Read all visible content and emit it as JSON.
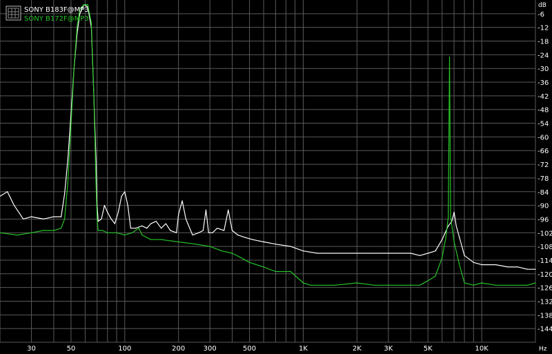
{
  "chart_data": {
    "type": "line",
    "title": "",
    "xlabel": "Hz",
    "ylabel": "dB",
    "x_scale": "log",
    "xlim": [
      20,
      20000
    ],
    "ylim": [
      -150,
      0
    ],
    "grid": true,
    "legend_position": "top-left",
    "y_ticks": [
      -6,
      -12,
      -18,
      -24,
      -30,
      -36,
      -42,
      -48,
      -54,
      -60,
      -66,
      -72,
      -78,
      -84,
      -90,
      -96,
      -102,
      -108,
      -114,
      -120,
      -126,
      -132,
      -138,
      -144
    ],
    "x_ticks": [
      {
        "value": 30,
        "label": "30"
      },
      {
        "value": 50,
        "label": "50"
      },
      {
        "value": 100,
        "label": "100"
      },
      {
        "value": 200,
        "label": "200"
      },
      {
        "value": 300,
        "label": "300"
      },
      {
        "value": 500,
        "label": "500"
      },
      {
        "value": 1000,
        "label": "1K"
      },
      {
        "value": 2000,
        "label": "2K"
      },
      {
        "value": 3000,
        "label": "3K"
      },
      {
        "value": 5000,
        "label": "5K"
      },
      {
        "value": 10000,
        "label": "10K"
      }
    ],
    "series": [
      {
        "name": "SONY B183F@MP3",
        "color": "#ffffff",
        "points": [
          [
            20,
            -86
          ],
          [
            22,
            -84
          ],
          [
            24,
            -90
          ],
          [
            27,
            -96
          ],
          [
            30,
            -95
          ],
          [
            35,
            -96
          ],
          [
            40,
            -95
          ],
          [
            44,
            -95
          ],
          [
            46,
            -85
          ],
          [
            48,
            -70
          ],
          [
            50,
            -50
          ],
          [
            52,
            -30
          ],
          [
            54,
            -15
          ],
          [
            56,
            -6
          ],
          [
            59,
            -2
          ],
          [
            62,
            -3
          ],
          [
            65,
            -12
          ],
          [
            67,
            -40
          ],
          [
            69,
            -70
          ],
          [
            70,
            -90
          ],
          [
            71,
            -97
          ],
          [
            74,
            -96
          ],
          [
            77,
            -90
          ],
          [
            80,
            -93
          ],
          [
            84,
            -96
          ],
          [
            88,
            -98
          ],
          [
            92,
            -93
          ],
          [
            96,
            -86
          ],
          [
            100,
            -84
          ],
          [
            104,
            -90
          ],
          [
            108,
            -100
          ],
          [
            115,
            -100
          ],
          [
            125,
            -99
          ],
          [
            133,
            -100
          ],
          [
            140,
            -98
          ],
          [
            150,
            -97
          ],
          [
            160,
            -100
          ],
          [
            170,
            -98
          ],
          [
            180,
            -101
          ],
          [
            195,
            -102
          ],
          [
            200,
            -94
          ],
          [
            210,
            -88
          ],
          [
            220,
            -96
          ],
          [
            240,
            -103
          ],
          [
            260,
            -102
          ],
          [
            275,
            -101
          ],
          [
            285,
            -92
          ],
          [
            295,
            -102
          ],
          [
            310,
            -102
          ],
          [
            330,
            -100
          ],
          [
            360,
            -101
          ],
          [
            380,
            -92
          ],
          [
            400,
            -101
          ],
          [
            430,
            -103
          ],
          [
            470,
            -104
          ],
          [
            520,
            -105
          ],
          [
            600,
            -106
          ],
          [
            700,
            -107
          ],
          [
            850,
            -108
          ],
          [
            1000,
            -110
          ],
          [
            1200,
            -111
          ],
          [
            1500,
            -111
          ],
          [
            2000,
            -111
          ],
          [
            2500,
            -111
          ],
          [
            3000,
            -111
          ],
          [
            3500,
            -111
          ],
          [
            4000,
            -111
          ],
          [
            4500,
            -112
          ],
          [
            5000,
            -111
          ],
          [
            5500,
            -110
          ],
          [
            6000,
            -105
          ],
          [
            6500,
            -99
          ],
          [
            6800,
            -97
          ],
          [
            7000,
            -93
          ],
          [
            7200,
            -99
          ],
          [
            7500,
            -104
          ],
          [
            8000,
            -112
          ],
          [
            9000,
            -115
          ],
          [
            10000,
            -116
          ],
          [
            12000,
            -116
          ],
          [
            14000,
            -117
          ],
          [
            16000,
            -117
          ],
          [
            18000,
            -118
          ],
          [
            20000,
            -118
          ]
        ]
      },
      {
        "name": "SONY B172F@MP3",
        "color": "#27c427",
        "points": [
          [
            20,
            -102
          ],
          [
            25,
            -103
          ],
          [
            30,
            -102
          ],
          [
            35,
            -101
          ],
          [
            40,
            -101
          ],
          [
            44,
            -100
          ],
          [
            46,
            -96
          ],
          [
            48,
            -80
          ],
          [
            50,
            -55
          ],
          [
            52,
            -30
          ],
          [
            54,
            -12
          ],
          [
            56,
            -4
          ],
          [
            59,
            -2
          ],
          [
            62,
            -2
          ],
          [
            65,
            -10
          ],
          [
            67,
            -40
          ],
          [
            69,
            -80
          ],
          [
            70,
            -96
          ],
          [
            71,
            -101
          ],
          [
            75,
            -101
          ],
          [
            80,
            -102
          ],
          [
            90,
            -102
          ],
          [
            100,
            -103
          ],
          [
            110,
            -102
          ],
          [
            120,
            -100
          ],
          [
            125,
            -103
          ],
          [
            140,
            -105
          ],
          [
            160,
            -105
          ],
          [
            200,
            -106
          ],
          [
            250,
            -107
          ],
          [
            300,
            -108
          ],
          [
            350,
            -110
          ],
          [
            400,
            -111
          ],
          [
            450,
            -113
          ],
          [
            500,
            -115
          ],
          [
            600,
            -117
          ],
          [
            700,
            -119
          ],
          [
            850,
            -119
          ],
          [
            1000,
            -124
          ],
          [
            1100,
            -125
          ],
          [
            1300,
            -125
          ],
          [
            1500,
            -125
          ],
          [
            2000,
            -124
          ],
          [
            2500,
            -125
          ],
          [
            3000,
            -125
          ],
          [
            3500,
            -125
          ],
          [
            4000,
            -125
          ],
          [
            4500,
            -125
          ],
          [
            5000,
            -123
          ],
          [
            5500,
            -121
          ],
          [
            6000,
            -113
          ],
          [
            6300,
            -104
          ],
          [
            6500,
            -95
          ],
          [
            6600,
            -25
          ],
          [
            6700,
            -95
          ],
          [
            7000,
            -106
          ],
          [
            7500,
            -116
          ],
          [
            8000,
            -124
          ],
          [
            9000,
            -125
          ],
          [
            10000,
            -124
          ],
          [
            12000,
            -125
          ],
          [
            14000,
            -125
          ],
          [
            16000,
            -125
          ],
          [
            18000,
            -125
          ],
          [
            20000,
            -124
          ]
        ]
      }
    ]
  }
}
